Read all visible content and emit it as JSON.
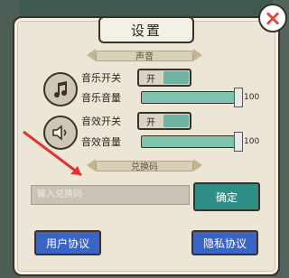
{
  "title": "设置",
  "close_icon": "close-icon",
  "sections": {
    "sound": "声音",
    "redeem": "兑换码"
  },
  "music": {
    "toggle_label": "音乐开关",
    "toggle_state_text": "开",
    "volume_label": "音乐音量",
    "volume_value": "100"
  },
  "sfx": {
    "toggle_label": "音效开关",
    "toggle_state_text": "开",
    "volume_label": "音效音量",
    "volume_value": "100"
  },
  "redeem": {
    "placeholder": "输入兑换码",
    "confirm_label": "确定"
  },
  "links": {
    "user_agreement": "用户协议",
    "privacy_agreement": "隐私协议"
  },
  "colors": {
    "accent_teal": "#2f8f86",
    "slider_fill": "#7fc2ae",
    "link_blue": "#3b65c5",
    "close_red": "#d7483a",
    "annotation_arrow_red": "#e2332f"
  }
}
